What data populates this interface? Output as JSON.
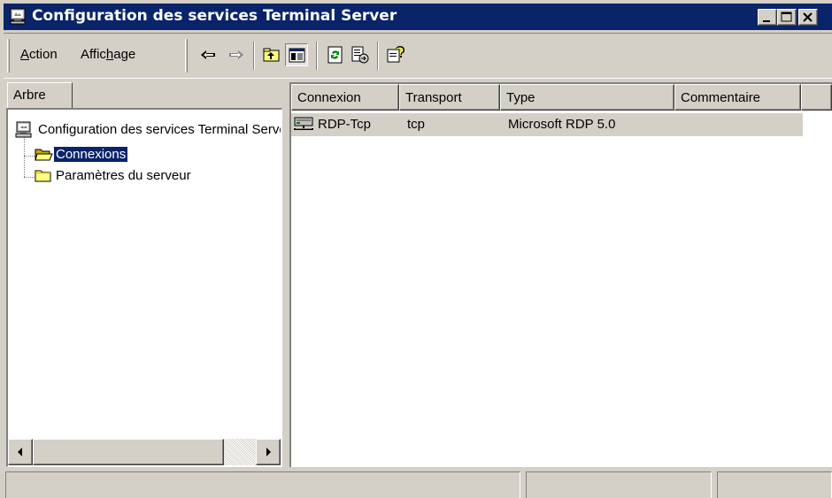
{
  "window": {
    "title": "Configuration des services Terminal Server",
    "app_icon": "terminal-server-icon",
    "controls": [
      "minimize-icon",
      "maximize-icon",
      "close-icon"
    ],
    "title_bar_color": "#0a246a",
    "face_color": "#d4d0c8"
  },
  "menu": {
    "items": [
      {
        "label": "Action",
        "mnemonic": "A"
      },
      {
        "label": "Affichage",
        "mnemonic": "h"
      }
    ]
  },
  "toolbar": {
    "buttons": [
      {
        "icon": "back-arrow-icon"
      },
      {
        "icon": "forward-arrow-icon"
      },
      {
        "icon": "up-one-level-icon"
      },
      {
        "icon": "show-hide-console-tree-icon",
        "pressed": true
      },
      {
        "icon": "refresh-icon"
      },
      {
        "icon": "export-list-icon"
      },
      {
        "icon": "help-icon"
      }
    ]
  },
  "left_panel": {
    "tab_label": "Arbre",
    "tree": [
      {
        "label": "Configuration des services Terminal Server",
        "icon": "terminal-server-icon",
        "level": 0
      },
      {
        "label": "Connexions",
        "icon": "open-folder-icon",
        "level": 1,
        "selected": true
      },
      {
        "label": "Paramètres du serveur",
        "icon": "folder-icon",
        "level": 1
      }
    ]
  },
  "list": {
    "columns": [
      "Connexion",
      "Transport",
      "Type",
      "Commentaire"
    ],
    "rows": [
      {
        "connexion": "RDP-Tcp",
        "transport": "tcp",
        "type": "Microsoft RDP 5.0",
        "commentaire": "",
        "icon": "network-connection-icon",
        "selected": true
      }
    ]
  },
  "statusbar": {
    "panels": [
      "",
      "",
      ""
    ]
  }
}
